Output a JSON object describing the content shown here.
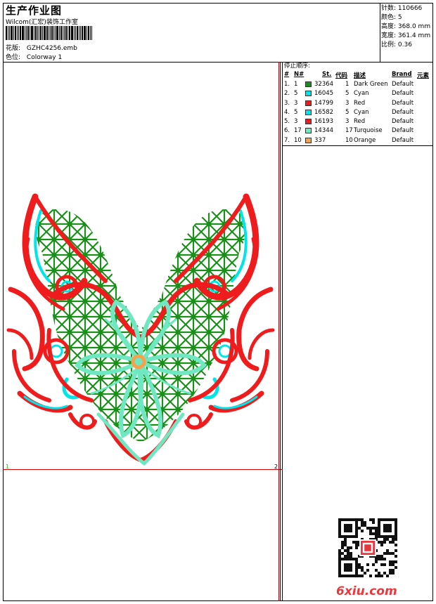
{
  "header": {
    "title": "生产作业图",
    "company": "Wilcom(汇宏)装饰工作室",
    "pattern_label": "花版:",
    "pattern_value": "GZHC4256.emb",
    "colorway_label": "色位:",
    "colorway_value": "Colorway 1"
  },
  "stats": [
    {
      "label": "针数:",
      "value": "110666"
    },
    {
      "label": "颜色:",
      "value": "5"
    },
    {
      "label": "高度:",
      "value": "368.0 mm"
    },
    {
      "label": "宽度:",
      "value": "361.4 mm"
    },
    {
      "label": "比例:",
      "value": "0.36"
    }
  ],
  "stops": {
    "heading": "停止顺序:",
    "columns": [
      "#",
      "N#",
      "St.",
      "代码",
      "描述",
      "Brand",
      "元素"
    ],
    "rows": [
      {
        "idx": "1.",
        "n": "1",
        "color": "#1a8f1a",
        "st": "32364",
        "code": "1",
        "desc": "Dark Green",
        "brand": "Default"
      },
      {
        "idx": "2.",
        "n": "5",
        "color": "#00e5e8",
        "st": "16045",
        "code": "5",
        "desc": "Cyan",
        "brand": "Default"
      },
      {
        "idx": "3.",
        "n": "3",
        "color": "#ee1c1c",
        "st": "14799",
        "code": "3",
        "desc": "Red",
        "brand": "Default"
      },
      {
        "idx": "4.",
        "n": "5",
        "color": "#00e5e8",
        "st": "16582",
        "code": "5",
        "desc": "Cyan",
        "brand": "Default"
      },
      {
        "idx": "5.",
        "n": "3",
        "color": "#ee1c1c",
        "st": "16193",
        "code": "3",
        "desc": "Red",
        "brand": "Default"
      },
      {
        "idx": "6.",
        "n": "17",
        "color": "#6fe8c2",
        "st": "14344",
        "code": "17",
        "desc": "Turquoise",
        "brand": "Default"
      },
      {
        "idx": "7.",
        "n": "10",
        "color": "#f7a14a",
        "st": "337",
        "code": "10",
        "desc": "Orange",
        "brand": "Default"
      }
    ]
  },
  "canvas": {
    "page_mark_left": "1",
    "page_mark_right": "2"
  },
  "watermark": {
    "brand": "6xiu.com",
    "stamp_text": "汇宏"
  },
  "colors": {
    "red": "#ee1c1c",
    "green": "#1a8f1a",
    "cyan": "#00e5e8",
    "turquoise": "#6fe8c2",
    "orange": "#f7a14a"
  }
}
